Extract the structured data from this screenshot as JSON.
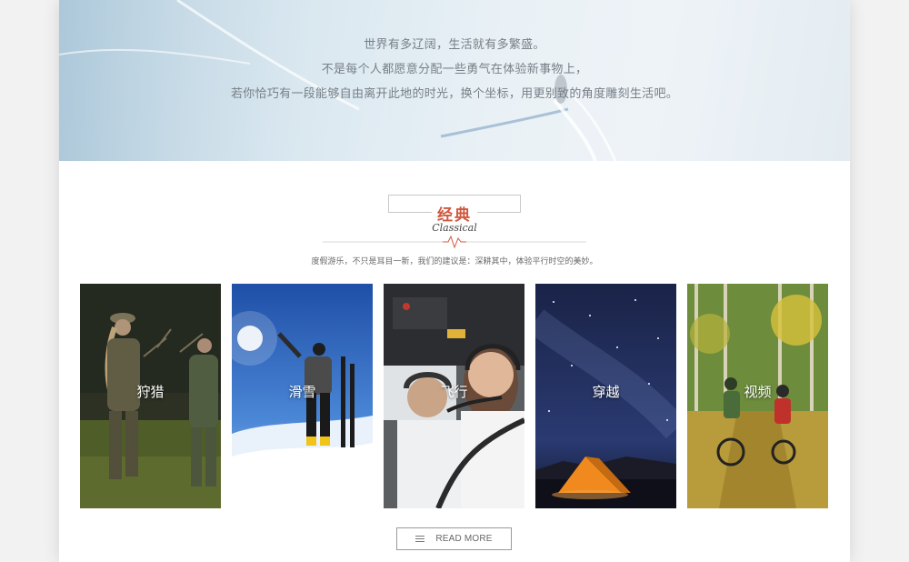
{
  "hero": {
    "lines": [
      "世界有多辽阔，生活就有多繁盛。",
      "不是每个人都愿意分配一些勇气在体验新事物上，",
      "若你恰巧有一段能够自由离开此地的时光，换个坐标，用更别致的角度雕刻生活吧。"
    ]
  },
  "section": {
    "title_cn": "经典",
    "title_en": "Classical",
    "subtitle": "度假游乐，不只是耳目一新，我们的建议是：深耕其中，体验平行时空的美妙。",
    "accent_color": "#d0583f"
  },
  "cards": [
    {
      "label": "狩猎",
      "icon": "hunting-photo"
    },
    {
      "label": "滑雪",
      "icon": "skiing-photo"
    },
    {
      "label": "飞行",
      "icon": "flying-photo"
    },
    {
      "label": "穿越",
      "icon": "crossing-photo"
    },
    {
      "label": "视频",
      "icon": "video-photo"
    }
  ],
  "read_more": {
    "label": "READ MORE",
    "icon": "menu-lines-icon"
  }
}
